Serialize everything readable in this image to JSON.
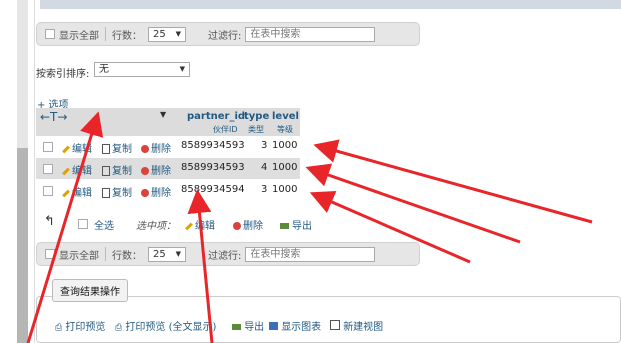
{
  "nav_top": {
    "show_all": "显示全部",
    "rows_label": "行数：",
    "rows_value": "25",
    "filter_label": "过滤行:",
    "filter_placeholder": "在表中搜索"
  },
  "index_sort": {
    "label": "按索引排序:",
    "value": "无"
  },
  "options_link": "+ 选项",
  "table": {
    "columns": [
      {
        "name": "partner_id",
        "sub": "伙伴ID"
      },
      {
        "name": "type",
        "sub": "类型"
      },
      {
        "name": "level",
        "sub": "等级"
      }
    ],
    "actions": {
      "edit": "编辑",
      "copy": "复制",
      "delete": "删除"
    },
    "rows": [
      {
        "partner_id": "8589934593",
        "type": "3",
        "level": "1000"
      },
      {
        "partner_id": "8589934593",
        "type": "4",
        "level": "1000"
      },
      {
        "partner_id": "8589934594",
        "type": "3",
        "level": "1000"
      }
    ]
  },
  "bulk": {
    "select_all": "全选",
    "with_selected": "选中项：",
    "edit": "编辑",
    "delete": "删除",
    "export": "导出"
  },
  "nav_bottom": {
    "show_all": "显示全部",
    "rows_label": "行数：",
    "rows_value": "25",
    "filter_label": "过滤行:",
    "filter_placeholder": "在表中搜索"
  },
  "query_ops": {
    "tooltip": "查询结果操作",
    "print": "打印预览",
    "print_full": "打印预览 (全文显示)",
    "export": "导出",
    "chart": "显示图表",
    "new_view": "新建视图"
  },
  "colors": {
    "accent": "#235a81",
    "arrow": "#e8262a"
  }
}
